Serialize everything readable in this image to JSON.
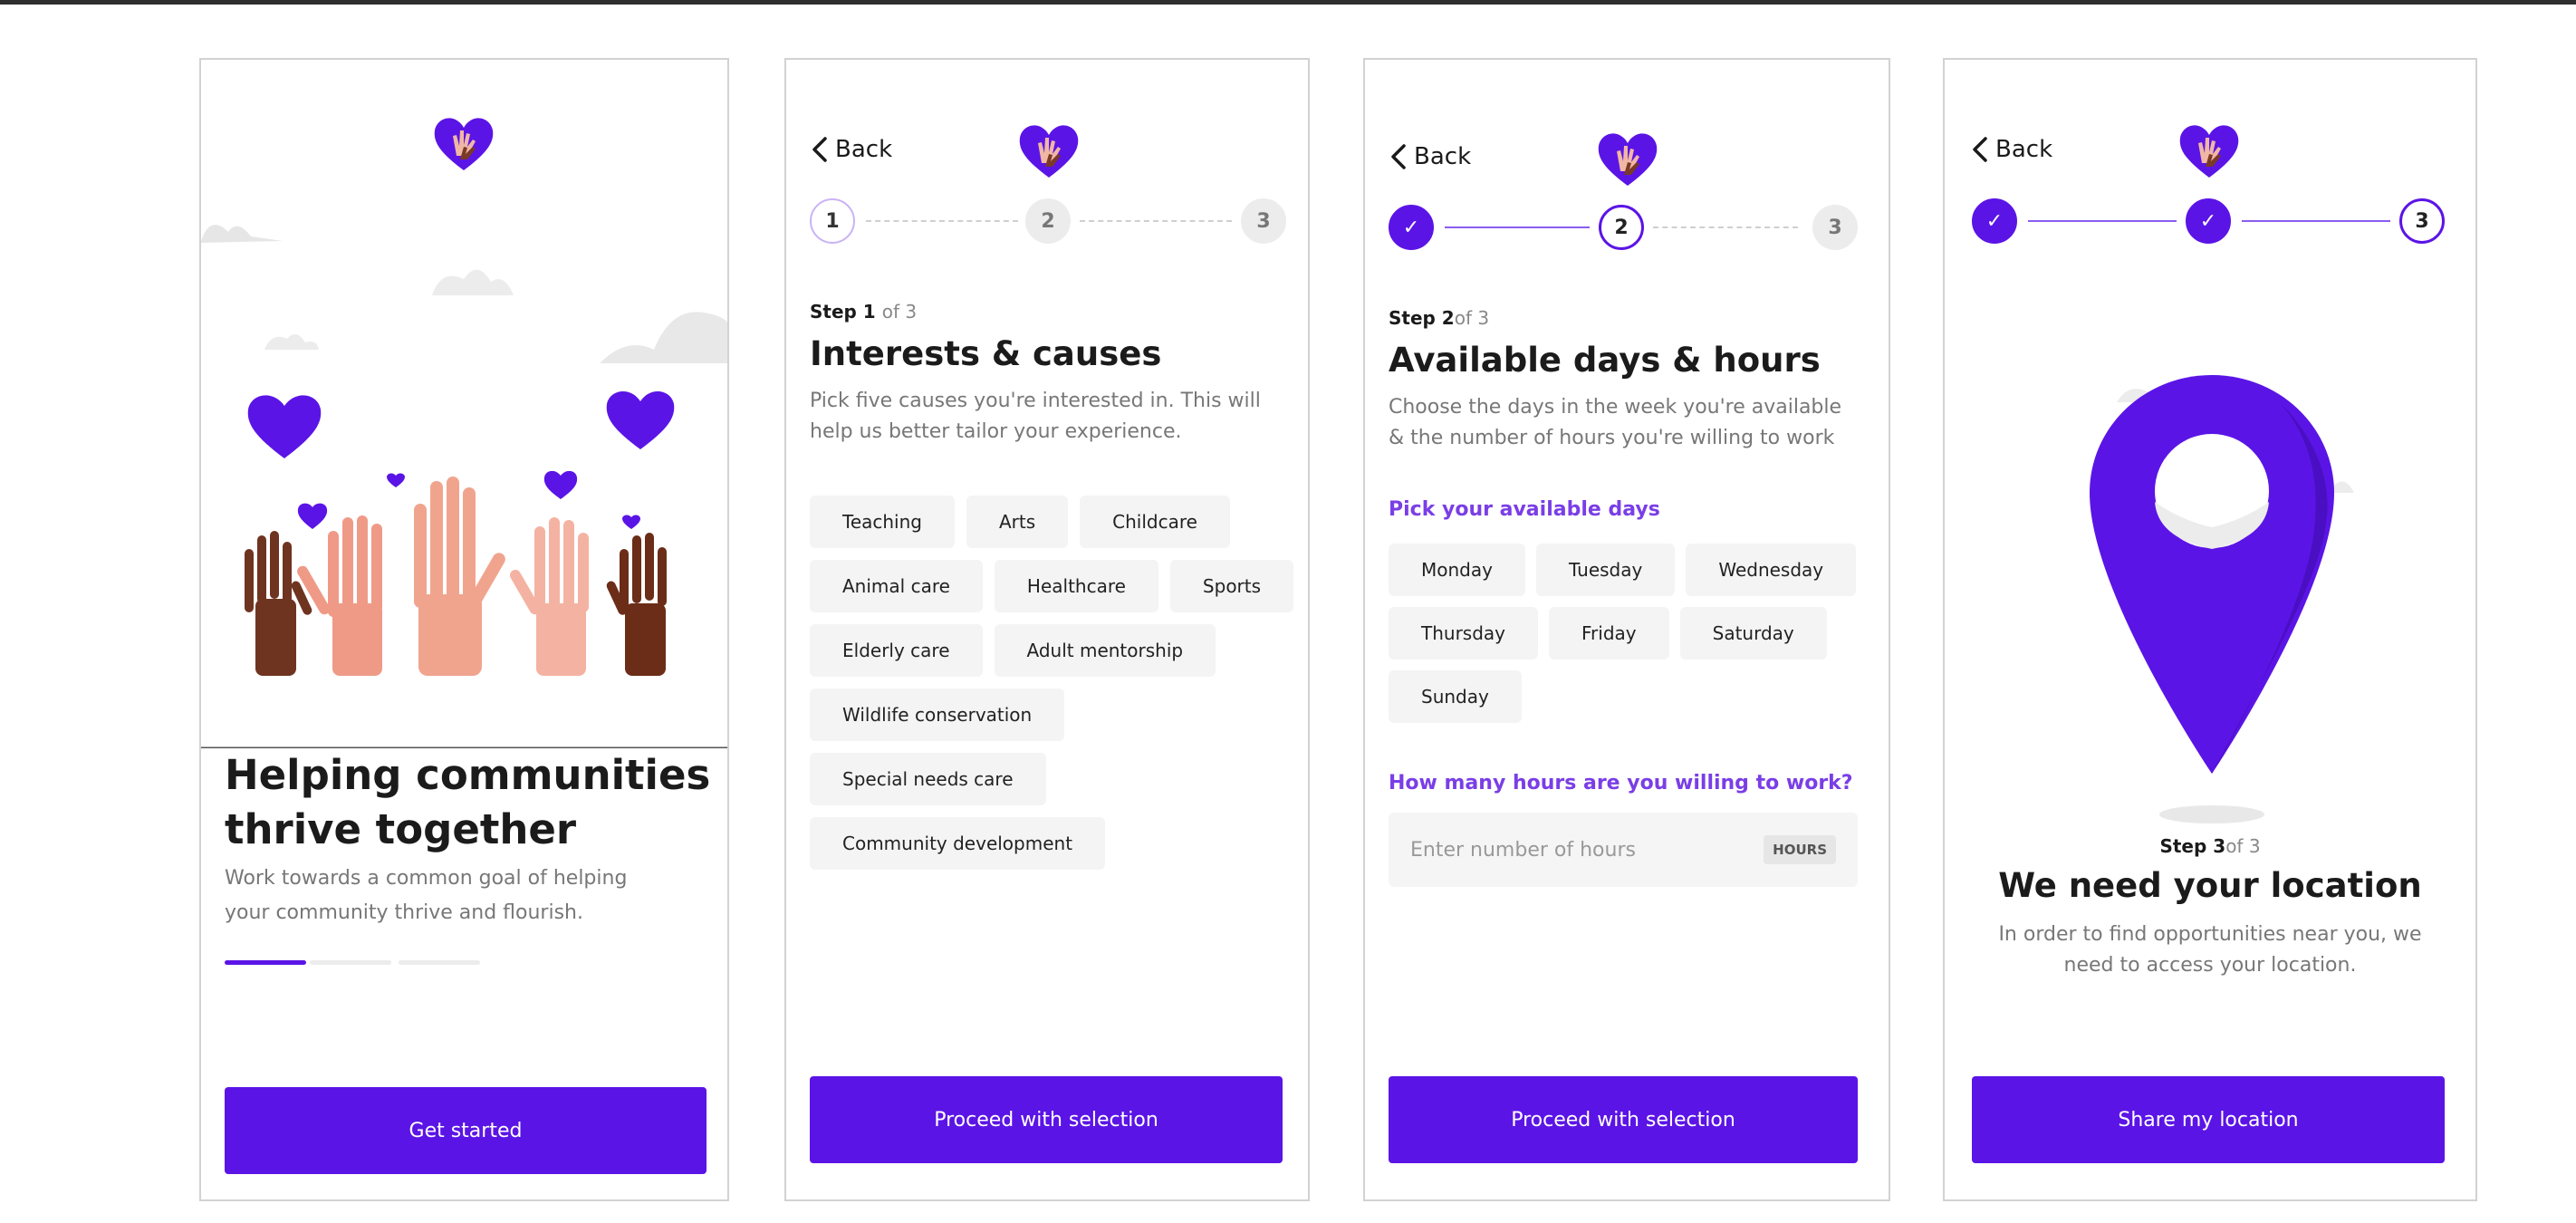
{
  "colors": {
    "accent": "#5b14e6",
    "accent_light": "#7a3ee6",
    "chip_bg": "#f4f4f4"
  },
  "screen1": {
    "headline": "Helping communities thrive together",
    "headline_line1": "Helping communities",
    "headline_line2": "thrive together",
    "subtitle_line1": "Work towards a common goal of helping",
    "subtitle_line2": "your community thrive and flourish.",
    "progress_current": 1,
    "progress_total": 3,
    "cta_label": "Get started"
  },
  "screen2": {
    "back_label": "Back",
    "steps": [
      "1",
      "2",
      "3"
    ],
    "step_prefix": "Step 1",
    "step_suffix": "of 3",
    "title": "Interests & causes",
    "desc_line1": "Pick five causes you're interested in. This will",
    "desc_line2": "help us better tailor your experience.",
    "causes": [
      "Teaching",
      "Arts",
      "Childcare",
      "Animal care",
      "Healthcare",
      "Sports",
      "Elderly care",
      "Adult mentorship",
      "Wildlife conservation",
      "Special needs care",
      "Community development"
    ],
    "cta_label": "Proceed with selection"
  },
  "screen3": {
    "back_label": "Back",
    "steps": [
      "✓",
      "2",
      "3"
    ],
    "step_prefix": "Step 2",
    "step_suffix": "of 3",
    "title": "Available days & hours",
    "desc_line1": "Choose the days in the week you're available",
    "desc_line2": "& the number of hours you're willing to work",
    "days_label": "Pick your available days",
    "days": [
      "Monday",
      "Tuesday",
      "Wednesday",
      "Thursday",
      "Friday",
      "Saturday",
      "Sunday"
    ],
    "hours_label": "How many hours are you willing to work?",
    "hours_placeholder": "Enter number of hours",
    "hours_unit": "HOURS",
    "cta_label": "Proceed with selection"
  },
  "screen4": {
    "back_label": "Back",
    "steps": [
      "✓",
      "✓",
      "3"
    ],
    "step_prefix": "Step 3",
    "step_suffix": "of 3",
    "title": "We need your location",
    "desc_line1": "In order to find opportunities near you, we",
    "desc_line2": "need to access your location.",
    "cta_label": "Share my location"
  }
}
